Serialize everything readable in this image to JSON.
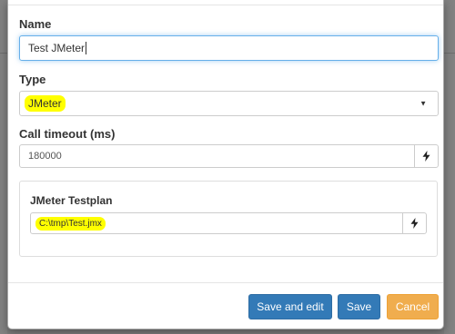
{
  "form": {
    "name_label": "Name",
    "name_value": "Test JMeter",
    "type_label": "Type",
    "type_value": "JMeter",
    "timeout_label": "Call timeout (ms)",
    "timeout_value": "180000",
    "testplan_panel_label": "JMeter Testplan",
    "testplan_value": "C:\\tmp\\Test.jmx"
  },
  "footer": {
    "save_edit_label": "Save and edit",
    "save_label": "Save",
    "cancel_label": "Cancel"
  },
  "icons": {
    "select_arrow": "chevron-down-icon",
    "addon": "bolt-icon"
  },
  "colors": {
    "primary": "#337ab7",
    "warning": "#f0ad4e",
    "highlight": "#ffff00",
    "focus": "#66afe9"
  }
}
